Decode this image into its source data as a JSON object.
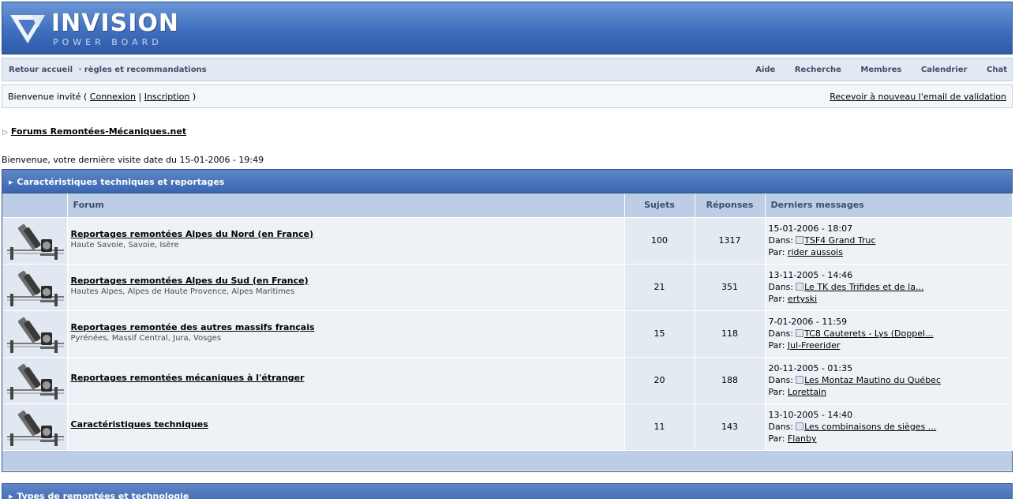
{
  "header": {
    "logo_title": "INVISION",
    "logo_subtitle": "POWER BOARD"
  },
  "nav": {
    "left": [
      "Retour accueil",
      "· règles et recommandations"
    ],
    "right": [
      "Aide",
      "Recherche",
      "Membres",
      "Calendrier",
      "Chat"
    ]
  },
  "userbar": {
    "welcome_prefix": "Bienvenue invité (",
    "login": "Connexion",
    "separator": "|",
    "register": "Inscription",
    "welcome_suffix": ")",
    "resend": "Recevoir à nouveau l'email de validation"
  },
  "breadcrumb": {
    "arrow": "▷",
    "label": "Forums Remontées-Mécaniques.net"
  },
  "last_visit": "Bienvenue, votre dernière visite date du 15-01-2006 - 19:49",
  "categories": [
    {
      "title": "Caractéristiques techniques et reportages",
      "columns": {
        "forum": "Forum",
        "topics": "Sujets",
        "replies": "Réponses",
        "last": "Derniers messages"
      },
      "forums": [
        {
          "name": "Reportages remontées Alpes du Nord (en France)",
          "desc": "Haute Savoie, Savoie, Isère",
          "topics": "100",
          "replies": "1317",
          "last_date": "15-01-2006 - 18:07",
          "in_label": "Dans:",
          "last_topic": "TSF4 Grand Truc",
          "by_label": "Par:",
          "last_user": "rider aussois"
        },
        {
          "name": "Reportages remontées Alpes du Sud (en France)",
          "desc": "Hautes Alpes, Alpes de Haute Provence, Alpes Maritimes",
          "topics": "21",
          "replies": "351",
          "last_date": "13-11-2005 - 14:46",
          "in_label": "Dans:",
          "last_topic": "Le TK des Trifides et de la...",
          "by_label": "Par:",
          "last_user": "ertyski"
        },
        {
          "name": "Reportages remontée des autres massifs français",
          "desc": "Pyrénées, Massif Central, Jura, Vosges",
          "topics": "15",
          "replies": "118",
          "last_date": "7-01-2006 - 11:59",
          "in_label": "Dans:",
          "last_topic": "TC8 Cauterets - Lys (Doppel...",
          "by_label": "Par:",
          "last_user": "Jul-Freerider"
        },
        {
          "name": "Reportages remontées mécaniques à l'étranger",
          "desc": "",
          "topics": "20",
          "replies": "188",
          "last_date": "20-11-2005 - 01:35",
          "in_label": "Dans:",
          "last_topic": "Les Montaz Mautino du Québec",
          "by_label": "Par:",
          "last_user": "Lorettain"
        },
        {
          "name": "Caractéristiques techniques",
          "desc": "",
          "topics": "11",
          "replies": "143",
          "last_date": "13-10-2005 - 14:40",
          "in_label": "Dans:",
          "last_topic": "Les combinaisons de sièges ...",
          "by_label": "Par:",
          "last_user": "Flanby"
        }
      ]
    },
    {
      "title": "Types de remontées et technologie"
    }
  ],
  "colors": {
    "header": "#3f6fbe",
    "column_head": "#bccde6",
    "nav_bg": "#e3e9f3"
  }
}
